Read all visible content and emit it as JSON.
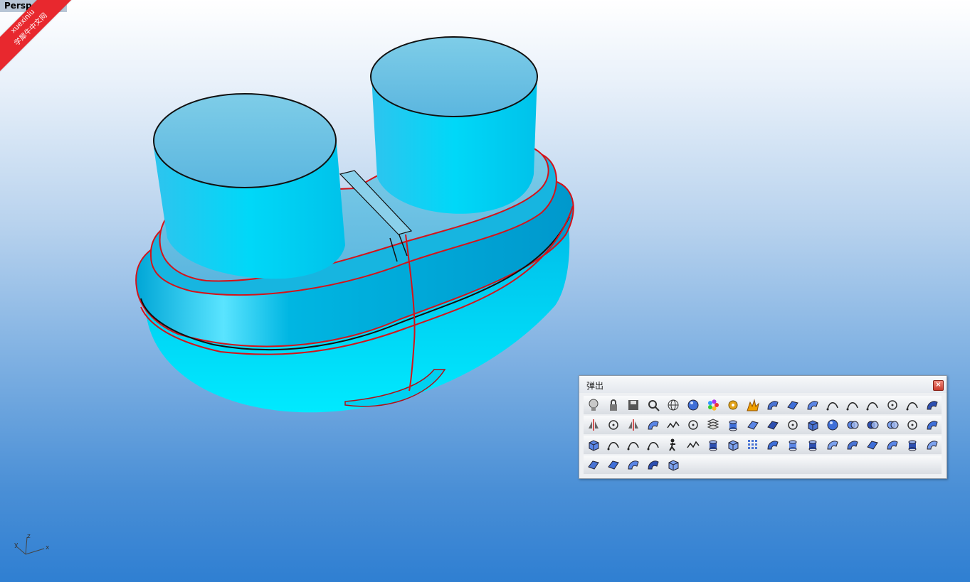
{
  "viewport": {
    "title": "Perspective"
  },
  "watermark": {
    "line1": "xuexiniu",
    "line2": "学犀牛中文网"
  },
  "axes": {
    "x": "x",
    "y": "y",
    "z": "z"
  },
  "colors": {
    "model": "#00cfee",
    "edge_red": "#d61218",
    "edge_black": "#111111"
  },
  "toolbar": {
    "title": "弹出",
    "close_label": "×",
    "rows": [
      [
        "light-bulb-icon",
        "lock-icon",
        "save-icon",
        "zoom-window-icon",
        "wireframe-sphere-icon",
        "shaded-sphere-icon",
        "color-wheel-icon",
        "gear-icon",
        "explode-icon",
        "pipe-icon",
        "surface-patch-icon",
        "sweep-icon",
        "rail-icon",
        "arc-icon",
        "blend-icon",
        "points-icon",
        "arch-icon",
        "revolve-icon"
      ],
      [
        "mirror-icon",
        "control-points-icon",
        "split-icon",
        "bend-icon",
        "polyline-icon",
        "circle-icon",
        "layers-icon",
        "cylinder-icon",
        "plane-icon",
        "plane2-icon",
        "circle2-icon",
        "box-icon",
        "sphere-icon",
        "boolean-union-icon",
        "boolean-diff-icon",
        "boolean-intersect-icon",
        "circle-numbered-icon",
        "loft-icon"
      ],
      [
        "solid-box-icon",
        "curve-icon",
        "curve2-icon",
        "curve3-icon",
        "walker-icon",
        "polyline2-icon",
        "stack-icon",
        "shell-icon",
        "grid-icon",
        "bend2-icon",
        "cylinder2-icon",
        "cylinder3-icon",
        "pipe2-icon",
        "pipe3-icon",
        "sheet-icon",
        "funnel-icon",
        "cap-icon",
        "fold-icon"
      ],
      [
        "flag-icon",
        "plane3-icon",
        "twist-icon",
        "swirl-icon",
        "door-icon"
      ]
    ]
  }
}
